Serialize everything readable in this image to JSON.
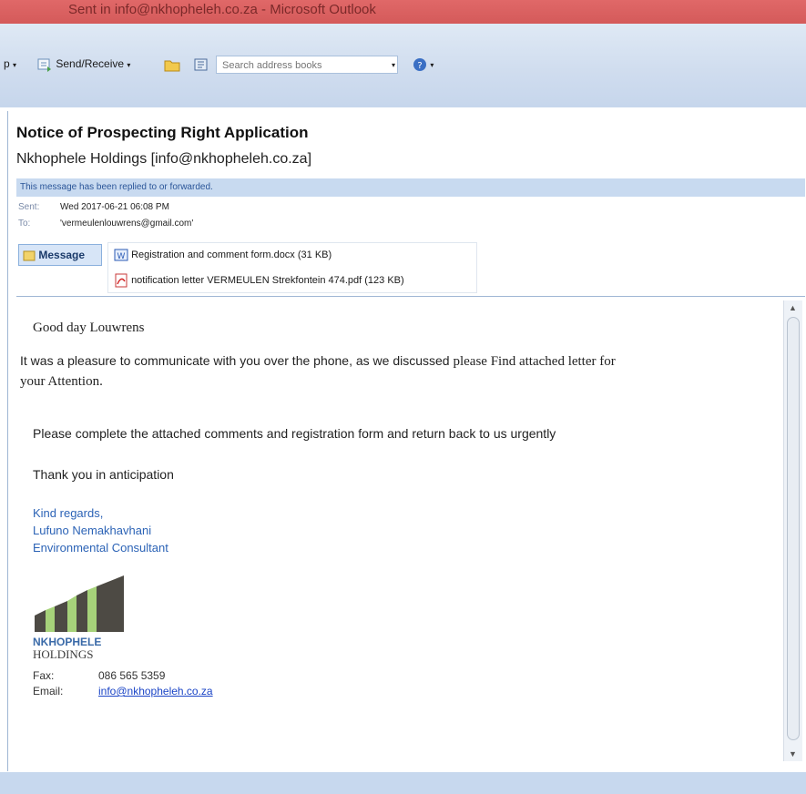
{
  "window": {
    "title": "Sent in info@nkhopheleh.co.za - Microsoft Outlook"
  },
  "toolbar": {
    "cut_label": "p",
    "send_receive_label": "Send/Receive",
    "search_placeholder": "Search address books"
  },
  "email": {
    "subject": "Notice of Prospecting Right Application",
    "from": "Nkhophele Holdings [info@nkhopheleh.co.za]",
    "info_bar": "This message has been replied to or forwarded.",
    "sent_label": "Sent:",
    "sent_value": "Wed 2017-06-21 06:08 PM",
    "to_label": "To:",
    "to_value": "'vermeulenlouwrens@gmail.com'",
    "message_tab": "Message",
    "attachments": [
      {
        "name": "Registration and comment form.docx (31 KB)",
        "type": "word-icon"
      },
      {
        "name": "notification letter VERMEULEN Strekfontein 474.pdf (123 KB)",
        "type": "pdf-icon"
      }
    ],
    "greeting": "Good day Louwrens",
    "line1a": "It was a pleasure to communicate with you over the phone, as we discussed ",
    "line1b": "please Find attached letter for",
    "line2": "your Attention.",
    "line3": "Please complete the attached comments and registration form and return back to us urgently",
    "line4": "Thank you in anticipation",
    "signature": [
      "Kind regards,",
      "Lufuno Nemakhavhani",
      "Environmental Consultant"
    ],
    "logo_name": "NKHOPHELE",
    "logo_sub": "HOLDINGS",
    "fax_label": "Fax:",
    "fax_value": "086 565 5359",
    "email_label": "Email:",
    "email_value": "info@nkhopheleh.co.za"
  },
  "colors": {
    "titlebar": "#d45a5a",
    "info_bar": "#c8daf0",
    "link": "#1a44c6",
    "signature": "#2c63b6"
  }
}
